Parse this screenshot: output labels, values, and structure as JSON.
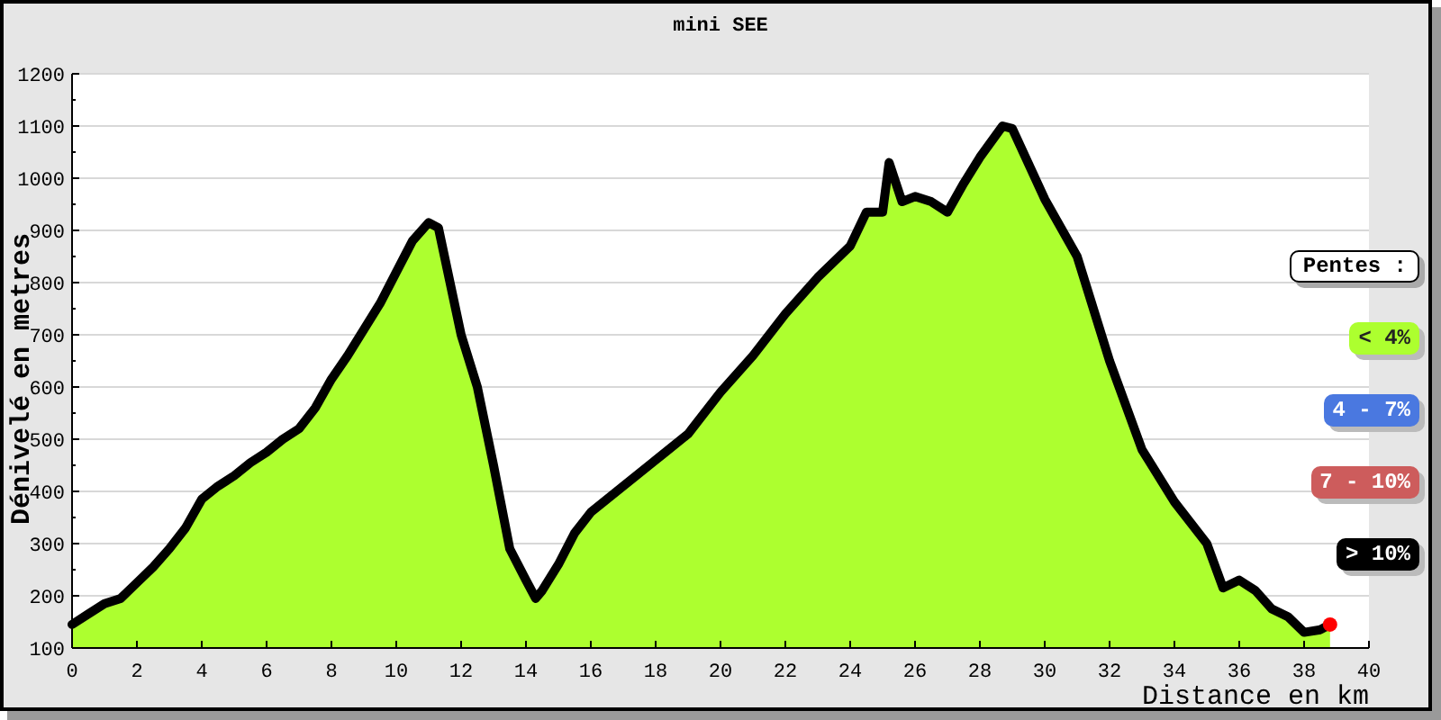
{
  "chart": {
    "chart_data": {
      "type": "area",
      "title": "mini SEE",
      "xlabel": "Distance en km",
      "ylabel": "Dénivelé en metres",
      "x": [
        0,
        0.5,
        1,
        1.5,
        2,
        2.5,
        3,
        3.5,
        4,
        4.5,
        5,
        5.5,
        6,
        6.5,
        7,
        7.5,
        8,
        8.5,
        9,
        9.5,
        10,
        10.5,
        11,
        11.3,
        12,
        12.5,
        13,
        13.5,
        14,
        14.3,
        14.5,
        15,
        15.5,
        16,
        17,
        18,
        19,
        20,
        21,
        22,
        23,
        24,
        24.5,
        25,
        25.2,
        25.6,
        26,
        26.5,
        27,
        27.5,
        28,
        28.7,
        29,
        30,
        31,
        32,
        33,
        34,
        35,
        35.5,
        36,
        36.5,
        37,
        37.5,
        38,
        38.5,
        38.8
      ],
      "series": [
        {
          "values": [
            145,
            165,
            185,
            195,
            225,
            255,
            290,
            330,
            385,
            410,
            430,
            455,
            475,
            500,
            520,
            560,
            615,
            660,
            710,
            760,
            820,
            880,
            915,
            905,
            700,
            600,
            450,
            290,
            230,
            195,
            210,
            260,
            320,
            360,
            410,
            460,
            510,
            590,
            660,
            740,
            810,
            870,
            935,
            935,
            1030,
            955,
            965,
            955,
            935,
            990,
            1040,
            1100,
            1095,
            960,
            850,
            650,
            480,
            380,
            300,
            215,
            230,
            210,
            175,
            160,
            130,
            135,
            145
          ]
        }
      ],
      "xlim": [
        0,
        40
      ],
      "ylim": [
        100,
        1200
      ],
      "xticks": [
        0,
        2,
        4,
        6,
        8,
        10,
        12,
        14,
        16,
        18,
        20,
        22,
        24,
        26,
        28,
        30,
        32,
        34,
        36,
        38,
        40
      ],
      "yticks": [
        100,
        200,
        300,
        400,
        500,
        600,
        700,
        800,
        900,
        1000,
        1100,
        1200
      ],
      "grid": true
    }
  },
  "legend": {
    "title": "Pentes :",
    "items": [
      {
        "label": "< 4%",
        "color": "#adff2f"
      },
      {
        "label": "4 - 7%",
        "color": "#4a78e0"
      },
      {
        "label": "7 - 10%",
        "color": "#cd5c5c"
      },
      {
        "label": "> 10%",
        "color": "#000000"
      }
    ]
  }
}
